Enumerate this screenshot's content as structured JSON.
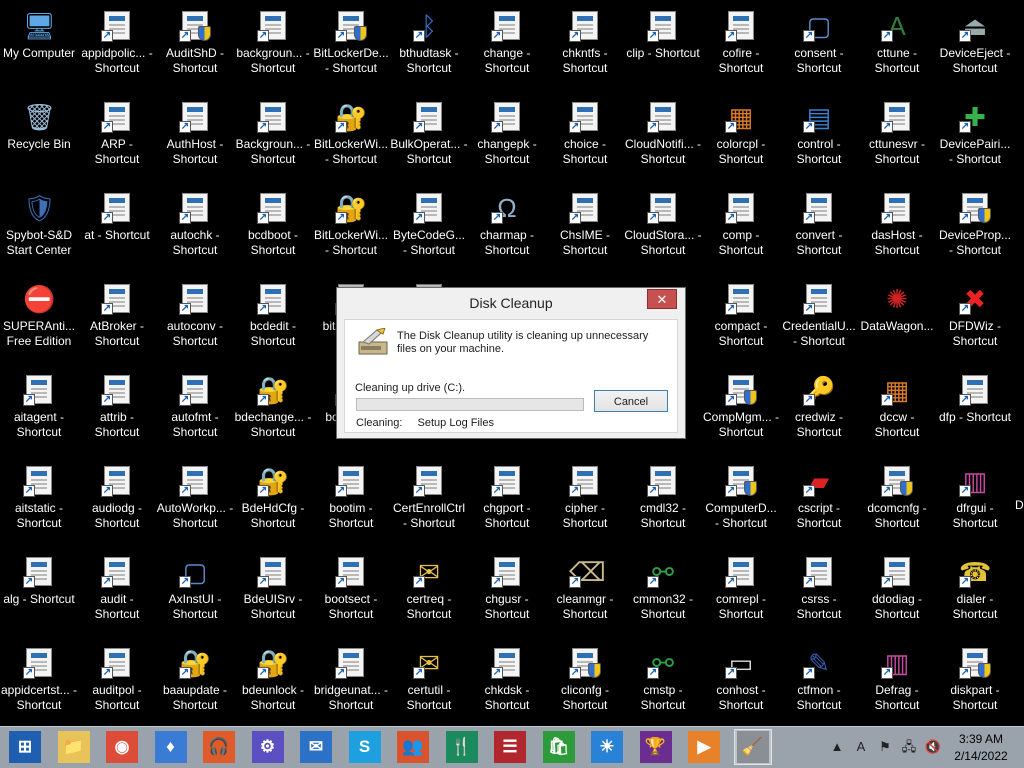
{
  "desktop": {
    "columns": [
      [
        {
          "label": "My Computer",
          "icon": "computer-icon"
        },
        {
          "label": "Recycle Bin",
          "icon": "recycle-bin-icon"
        },
        {
          "label": "Spybot-S&D Start Center",
          "icon": "spybot-icon"
        },
        {
          "label": "SUPERAnti... Free Edition",
          "icon": "superantispyware-icon"
        },
        {
          "label": "aitagent - Shortcut",
          "icon": "shortcut-icon"
        },
        {
          "label": "aitstatic - Shortcut",
          "icon": "shortcut-icon"
        },
        {
          "label": "alg - Shortcut",
          "icon": "shortcut-icon"
        },
        {
          "label": "appidcertst... - Shortcut",
          "icon": "shortcut-icon"
        }
      ],
      [
        {
          "label": "appidpolic... - Shortcut",
          "icon": "shortcut-icon"
        },
        {
          "label": "ARP - Shortcut",
          "icon": "shortcut-icon"
        },
        {
          "label": "at - Shortcut",
          "icon": "shortcut-icon"
        },
        {
          "label": "AtBroker - Shortcut",
          "icon": "shortcut-icon"
        },
        {
          "label": "attrib - Shortcut",
          "icon": "shortcut-icon"
        },
        {
          "label": "audiodg - Shortcut",
          "icon": "shortcut-icon"
        },
        {
          "label": "audit - Shortcut",
          "icon": "shortcut-icon"
        },
        {
          "label": "auditpol - Shortcut",
          "icon": "shortcut-icon"
        }
      ],
      [
        {
          "label": "AuditShD - Shortcut",
          "icon": "shield-shortcut-icon"
        },
        {
          "label": "AuthHost - Shortcut",
          "icon": "shortcut-icon"
        },
        {
          "label": "autochk - Shortcut",
          "icon": "shortcut-icon"
        },
        {
          "label": "autoconv - Shortcut",
          "icon": "shortcut-icon"
        },
        {
          "label": "autofmt - Shortcut",
          "icon": "shortcut-icon"
        },
        {
          "label": "AutoWorkp... - Shortcut",
          "icon": "shortcut-icon"
        },
        {
          "label": "AxInstUI - Shortcut",
          "icon": "window-shortcut-icon"
        },
        {
          "label": "baaupdate - Shortcut",
          "icon": "keys-shortcut-icon"
        }
      ],
      [
        {
          "label": "backgroun... - Shortcut",
          "icon": "shortcut-icon"
        },
        {
          "label": "Backgroun... - Shortcut",
          "icon": "shortcut-icon"
        },
        {
          "label": "bcdboot - Shortcut",
          "icon": "shortcut-icon"
        },
        {
          "label": "bcdedit - Shortcut",
          "icon": "shortcut-icon"
        },
        {
          "label": "bdechange... - Shortcut",
          "icon": "keys-shortcut-icon"
        },
        {
          "label": "BdeHdCfg - Shortcut",
          "icon": "keys-shortcut-icon"
        },
        {
          "label": "BdeUISrv - Shortcut",
          "icon": "shortcut-icon"
        },
        {
          "label": "bdeunlock - Shortcut",
          "icon": "keys-shortcut-icon"
        }
      ],
      [
        {
          "label": "BitLockerDe... - Shortcut",
          "icon": "shield-shortcut-icon"
        },
        {
          "label": "BitLockerWi... - Shortcut",
          "icon": "keys-shortcut-icon"
        },
        {
          "label": "BitLockerWi... - Shortcut",
          "icon": "keys-shortcut-icon"
        },
        {
          "label": "bits... Sh...",
          "icon": "shortcut-icon"
        },
        {
          "label": "bo... Sh...",
          "icon": "shortcut-icon"
        },
        {
          "label": "bootim - Shortcut",
          "icon": "shortcut-icon"
        },
        {
          "label": "bootsect - Shortcut",
          "icon": "shortcut-icon"
        },
        {
          "label": "bridgeunat... - Shortcut",
          "icon": "shortcut-icon"
        }
      ],
      [
        {
          "label": "bthudtask - Shortcut",
          "icon": "bluetooth-shortcut-icon"
        },
        {
          "label": "BulkOperat... - Shortcut",
          "icon": "shortcut-icon"
        },
        {
          "label": "ByteCodeG... - Shortcut",
          "icon": "shortcut-icon"
        },
        {
          "label": "",
          "icon": "shortcut-icon"
        },
        {
          "label": "",
          "icon": "shortcut-icon"
        },
        {
          "label": "CertEnrollCtrl - Shortcut",
          "icon": "shortcut-icon"
        },
        {
          "label": "certreq - Shortcut",
          "icon": "certificate-shortcut-icon"
        },
        {
          "label": "certutil - Shortcut",
          "icon": "certificate-shortcut-icon"
        }
      ],
      [
        {
          "label": "change - Shortcut",
          "icon": "shortcut-icon"
        },
        {
          "label": "changepk - Shortcut",
          "icon": "shortcut-icon"
        },
        {
          "label": "charmap - Shortcut",
          "icon": "charmap-shortcut-icon"
        },
        {
          "label": "",
          "icon": ""
        },
        {
          "label": "",
          "icon": ""
        },
        {
          "label": "chgport - Shortcut",
          "icon": "shortcut-icon"
        },
        {
          "label": "chgusr - Shortcut",
          "icon": "shortcut-icon"
        },
        {
          "label": "chkdsk - Shortcut",
          "icon": "shortcut-icon"
        }
      ],
      [
        {
          "label": "chkntfs - Shortcut",
          "icon": "shortcut-icon"
        },
        {
          "label": "choice - Shortcut",
          "icon": "shortcut-icon"
        },
        {
          "label": "ChsIME - Shortcut",
          "icon": "shortcut-icon"
        },
        {
          "label": "",
          "icon": ""
        },
        {
          "label": "",
          "icon": ""
        },
        {
          "label": "cipher - Shortcut",
          "icon": "shortcut-icon"
        },
        {
          "label": "cleanmgr - Shortcut",
          "icon": "disk-cleanup-shortcut-icon"
        },
        {
          "label": "cliconfg - Shortcut",
          "icon": "shield-shortcut-icon"
        }
      ],
      [
        {
          "label": "clip - Shortcut",
          "icon": "shortcut-icon"
        },
        {
          "label": "CloudNotifi... - Shortcut",
          "icon": "shortcut-icon"
        },
        {
          "label": "CloudStora... - Shortcut",
          "icon": "shortcut-icon"
        },
        {
          "label": "",
          "icon": ""
        },
        {
          "label": "",
          "icon": ""
        },
        {
          "label": "cmdl32 - Shortcut",
          "icon": "shortcut-icon"
        },
        {
          "label": "cmmon32 - Shortcut",
          "icon": "network-shortcut-icon"
        },
        {
          "label": "cmstp - Shortcut",
          "icon": "network-shortcut-icon"
        }
      ],
      [
        {
          "label": "cofire - Shortcut",
          "icon": "shortcut-icon"
        },
        {
          "label": "colorcpl - Shortcut",
          "icon": "color-shortcut-icon"
        },
        {
          "label": "comp - Shortcut",
          "icon": "shortcut-icon"
        },
        {
          "label": "compact - Shortcut",
          "icon": "shortcut-icon"
        },
        {
          "label": "CompMgm... - Shortcut",
          "icon": "shield-shortcut-icon"
        },
        {
          "label": "ComputerD... - Shortcut",
          "icon": "shield-shortcut-icon"
        },
        {
          "label": "comrepl - Shortcut",
          "icon": "shortcut-icon"
        },
        {
          "label": "conhost - Shortcut",
          "icon": "console-shortcut-icon"
        }
      ],
      [
        {
          "label": "consent - Shortcut",
          "icon": "window-shortcut-icon"
        },
        {
          "label": "control - Shortcut",
          "icon": "control-panel-shortcut-icon"
        },
        {
          "label": "convert - Shortcut",
          "icon": "shortcut-icon"
        },
        {
          "label": "CredentialU... - Shortcut",
          "icon": "shortcut-icon"
        },
        {
          "label": "credwiz - Shortcut",
          "icon": "key-shortcut-icon"
        },
        {
          "label": "cscript - Shortcut",
          "icon": "script-shortcut-icon"
        },
        {
          "label": "csrss - Shortcut",
          "icon": "shortcut-icon"
        },
        {
          "label": "ctfmon - Shortcut",
          "icon": "pen-shortcut-icon"
        }
      ],
      [
        {
          "label": "cttune - Shortcut",
          "icon": "font-shortcut-icon"
        },
        {
          "label": "cttunesvr - Shortcut",
          "icon": "shortcut-icon"
        },
        {
          "label": "dasHost - Shortcut",
          "icon": "shortcut-icon"
        },
        {
          "label": "DataWagon...",
          "icon": "datawagon-icon"
        },
        {
          "label": "dccw - Shortcut",
          "icon": "color-shortcut-icon"
        },
        {
          "label": "dcomcnfg - Shortcut",
          "icon": "shield-shortcut-icon"
        },
        {
          "label": "ddodiag - Shortcut",
          "icon": "shortcut-icon"
        },
        {
          "label": "Defrag - Shortcut",
          "icon": "defrag-shortcut-icon"
        }
      ],
      [
        {
          "label": "DeviceEject - Shortcut",
          "icon": "eject-shortcut-icon"
        },
        {
          "label": "DevicePairi... - Shortcut",
          "icon": "device-pair-shortcut-icon"
        },
        {
          "label": "DeviceProp... - Shortcut",
          "icon": "shield-shortcut-icon"
        },
        {
          "label": "DFDWiz - Shortcut",
          "icon": "error-shortcut-icon"
        },
        {
          "label": "dfp - Shortcut",
          "icon": "shortcut-icon"
        },
        {
          "label": "dfrgui - Shortcut",
          "icon": "defrag-shortcut-icon"
        },
        {
          "label": "dialer - Shortcut",
          "icon": "phone-shortcut-icon"
        },
        {
          "label": "diskpart - Shortcut",
          "icon": "shield-shortcut-icon"
        }
      ]
    ],
    "partial_label": "D"
  },
  "dialog": {
    "title": "Disk Cleanup",
    "close_glyph": "✕",
    "message": "The Disk Cleanup utility is cleaning up unnecessary files on your machine.",
    "drive_label": "Cleaning up drive  (C:).",
    "progress_percent": 0,
    "cancel_label": "Cancel",
    "status_label": "Cleaning:",
    "status_value": "Setup Log Files"
  },
  "taskbar": {
    "items": [
      {
        "name": "start-button",
        "glyph": "⊞",
        "color": "#1f5fb0"
      },
      {
        "name": "file-explorer",
        "glyph": "📁",
        "color": "#e8c35a"
      },
      {
        "name": "chrome",
        "glyph": "◉",
        "color": "#dd4b39"
      },
      {
        "name": "app-blue-flame",
        "glyph": "♦",
        "color": "#3a7bd5"
      },
      {
        "name": "music-app",
        "glyph": "🎧",
        "color": "#e05a2a"
      },
      {
        "name": "settings-app",
        "glyph": "⚙",
        "color": "#5b4fc2"
      },
      {
        "name": "mail-app",
        "glyph": "✉",
        "color": "#2b72c7"
      },
      {
        "name": "skype",
        "glyph": "S",
        "color": "#1ea0e0"
      },
      {
        "name": "people-app",
        "glyph": "👥",
        "color": "#d9532c"
      },
      {
        "name": "food-app",
        "glyph": "🍴",
        "color": "#1b8a5c"
      },
      {
        "name": "news-app",
        "glyph": "☰",
        "color": "#b2272d"
      },
      {
        "name": "store-app",
        "glyph": "🛍",
        "color": "#2e9b3a"
      },
      {
        "name": "weather-app",
        "glyph": "☀",
        "color": "#2a82d6"
      },
      {
        "name": "games-app",
        "glyph": "🏆",
        "color": "#6b2d8f"
      },
      {
        "name": "video-app",
        "glyph": "▶",
        "color": "#e8822a"
      },
      {
        "name": "disk-cleanup-taskbar",
        "glyph": "🧹",
        "color": "#8a8f94"
      }
    ],
    "tray": [
      {
        "name": "show-hidden-icons",
        "glyph": "▲"
      },
      {
        "name": "acrobat-tray",
        "glyph": "A"
      },
      {
        "name": "action-center-flag",
        "glyph": "⚑"
      },
      {
        "name": "network-tray",
        "glyph": "🖧"
      },
      {
        "name": "volume-muted",
        "glyph": "🔇"
      }
    ],
    "time": "3:39 AM",
    "date": "2/14/2022"
  }
}
